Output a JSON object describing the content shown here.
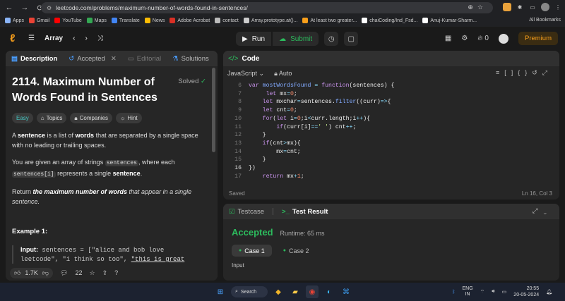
{
  "browser": {
    "url": "leetcode.com/problems/maximum-number-of-words-found-in-sentences/",
    "bookmarks": [
      {
        "label": "Apps",
        "color": "#8ab4f8"
      },
      {
        "label": "Gmail",
        "color": "#ea4335"
      },
      {
        "label": "YouTube",
        "color": "#ff0000"
      },
      {
        "label": "Maps",
        "color": "#34a853"
      },
      {
        "label": "Translate",
        "color": "#4285f4"
      },
      {
        "label": "News",
        "color": "#fbbc04"
      },
      {
        "label": "Adobe Acrobat",
        "color": "#d93025"
      },
      {
        "label": "contact",
        "color": "#bbbbbb"
      },
      {
        "label": "Array.prototype.at()...",
        "color": "#cccccc"
      },
      {
        "label": "At least two greater...",
        "color": "#f89f1b"
      },
      {
        "label": "chaiCoding/Ind_Fsd...",
        "color": "#ffffff"
      },
      {
        "label": "Anuj-Kumar-Sharm...",
        "color": "#ffffff"
      }
    ],
    "all_bookmarks": "All Bookmarks"
  },
  "header": {
    "problem_list": "Array",
    "run": "Run",
    "submit": "Submit",
    "streak": "0",
    "premium": "Premium"
  },
  "left": {
    "tabs": [
      "Description",
      "Accepted",
      "Editorial",
      "Solutions",
      "Su"
    ],
    "title": "2114. Maximum Number of Words Found in Sentences",
    "solved": "Solved",
    "tags": [
      "Easy",
      "Topics",
      "Companies",
      "Hint"
    ],
    "p1a": "A ",
    "p1b": "sentence",
    "p1c": " is a list of ",
    "p1d": "words",
    "p1e": " that are separated by a single space with no leading or trailing spaces.",
    "p2a": "You are given an array of strings ",
    "p2code": "sentences",
    "p2b": ", where each ",
    "p2code2": "sentences[i]",
    "p2c": " represents a single ",
    "p2d": "sentence",
    "p2e": ".",
    "p3a": "Return ",
    "p3b": "the maximum number of words",
    "p3c": " that appear in a single sentence.",
    "example": "Example 1:",
    "input_label": "Input:",
    "input_line1": " sentences = [\"alice and bob love",
    "input_line2a": "leetcode\", \"i think so too\", ",
    "input_line2b": "\"this is great",
    "likes": "1.7K",
    "comments": "22"
  },
  "code": {
    "header": "Code",
    "language": "JavaScript",
    "mode": "Auto",
    "line_numbers": [
      "6",
      "7",
      "8",
      "9",
      "10",
      "11",
      "12",
      "13",
      "14",
      "15",
      "16",
      "17"
    ],
    "status": "Saved",
    "cursor": "Ln 16, Col 3"
  },
  "result": {
    "tabs": [
      "Testcase",
      "Test Result"
    ],
    "verdict": "Accepted",
    "runtime": "Runtime: 65 ms",
    "cases": [
      "Case 1",
      "Case 2"
    ],
    "input_label": "Input"
  },
  "taskbar": {
    "search": "Search",
    "lang1": "ENG",
    "lang2": "IN",
    "time": "20:55",
    "date": "20-05-2024"
  }
}
